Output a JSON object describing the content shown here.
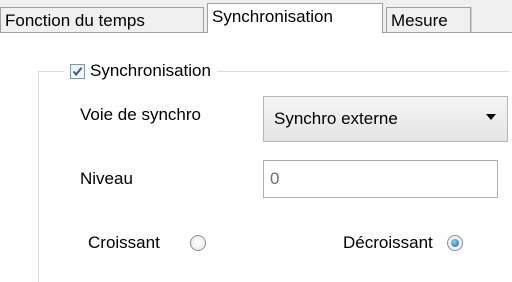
{
  "tabs": [
    {
      "label": "Fonction du temps",
      "selected": false
    },
    {
      "label": "Synchronisation",
      "selected": true
    },
    {
      "label": "Mesure",
      "selected": false
    }
  ],
  "group": {
    "checkbox_label": "Synchronisation",
    "checked": true
  },
  "fields": {
    "voie_label": "Voie de synchro",
    "voie_value": "Synchro externe",
    "niveau_label": "Niveau",
    "niveau_value": "0"
  },
  "radios": {
    "croissant_label": "Croissant",
    "croissant_checked": false,
    "decroissant_label": "Décroissant",
    "decroissant_checked": true
  },
  "icons": {
    "checkbox": "checkmark-icon",
    "dropdown": "chevron-down-icon"
  },
  "colors": {
    "check_mark": "#3a5a8c",
    "radio_selected": "#1f5c9a"
  }
}
